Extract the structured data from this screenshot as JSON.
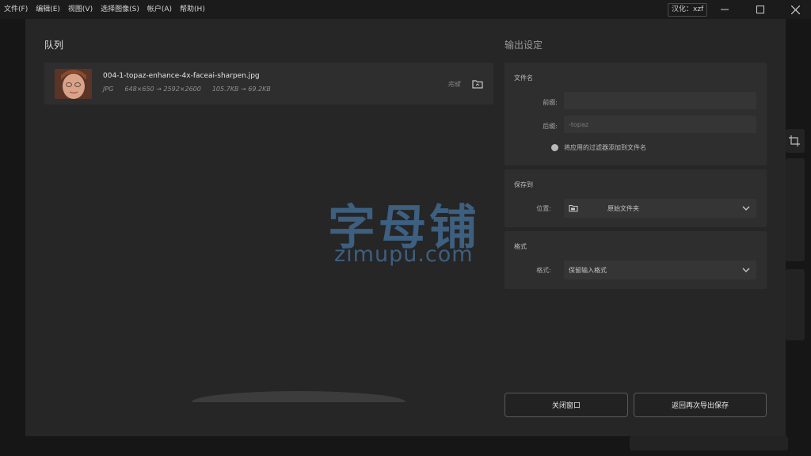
{
  "menu": [
    "文件(F)",
    "编辑(E)",
    "视图(V)",
    "选择图像(S)",
    "帐户(A)",
    "帮助(H)"
  ],
  "lang_badge": "汉化：xzf",
  "queue": {
    "title": "队列",
    "items": [
      {
        "file_name": "004-1-topaz-enhance-4x-faceai-sharpen.jpg",
        "format": "JPG",
        "dimensions": "648×650 → 2592×2600",
        "size": "105.7KB → 69.2KB",
        "status": "完成"
      }
    ]
  },
  "watermark": {
    "cn": "字母铺",
    "en": "zimupu.com"
  },
  "output": {
    "title": "输出设定",
    "filename_section": {
      "title": "文件名",
      "prefix_label": "前缀:",
      "prefix_value": "",
      "suffix_label": "后缀:",
      "suffix_value": "-topaz",
      "toggle_label": "将应用的过滤器添加到文件名"
    },
    "saveto_section": {
      "title": "保存到",
      "location_label": "位置:",
      "location_value": "原始文件夹"
    },
    "format_section": {
      "title": "格式",
      "format_label": "格式:",
      "format_value": "保留输入格式"
    }
  },
  "buttons": {
    "close": "关闭窗口",
    "return": "返回再次导出保存"
  },
  "colors": {
    "accent_watermark": "#3d5f80",
    "modal_bg": "#262626",
    "panel_bg": "#2e2e2e"
  }
}
